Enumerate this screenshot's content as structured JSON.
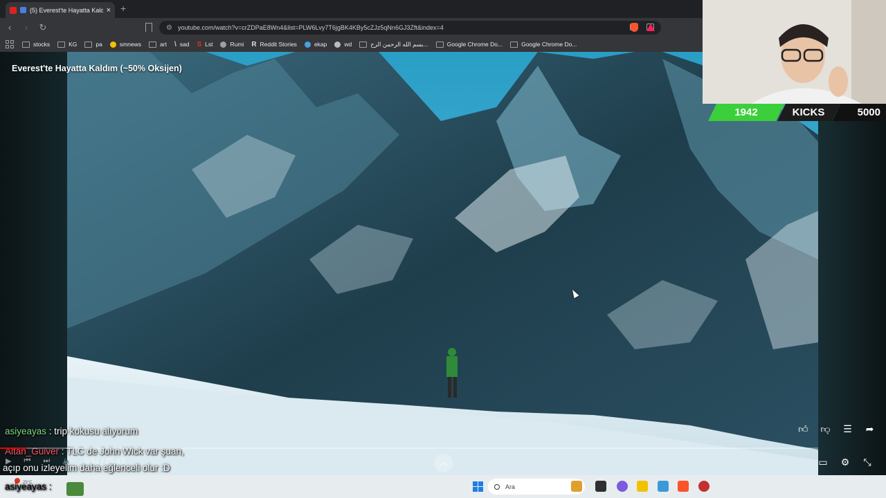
{
  "browser": {
    "tab": {
      "title": "(5) Everest'te Hayatta Kaldım"
    },
    "url": "youtube.com/watch?v=crZDPaE8Wn4&list=PLW6Lvy7T6jgBK4KBy5cZJz5qNn6GJ3Zft&index=4",
    "bookmarks": [
      {
        "label": "stocks",
        "kind": "folder"
      },
      {
        "label": "KG",
        "kind": "folder"
      },
      {
        "label": "pa",
        "kind": "folder"
      },
      {
        "label": "smnews",
        "kind": "site",
        "color": "#f2c200"
      },
      {
        "label": "art",
        "kind": "folder"
      },
      {
        "label": "sad",
        "kind": "site-glyph",
        "glyph": "\\"
      },
      {
        "label": "Lst",
        "kind": "site-glyph",
        "glyph": "S",
        "color": "#e0341f"
      },
      {
        "label": "Rumi",
        "kind": "site",
        "color": "#9aa0a6"
      },
      {
        "label": "Reddit Stories",
        "kind": "site-glyph",
        "glyph": "R"
      },
      {
        "label": "ekap",
        "kind": "site",
        "color": "#4aa0e0"
      },
      {
        "label": "wd",
        "kind": "site",
        "color": "#bbbbbb"
      },
      {
        "label": "بسم الله الرحمن الرح...",
        "kind": "doc"
      },
      {
        "label": "Google Chrome Do...",
        "kind": "folder"
      },
      {
        "label": "Google Chrome Do...",
        "kind": "folder"
      }
    ]
  },
  "video": {
    "title": "Everest'te Hayatta Kaldım (~50% Oksijen)",
    "time": "0:51 / 25:43",
    "progress": 0.033
  },
  "overlay": {
    "kicks_count": "1942",
    "kicks_label": "KICKS",
    "kicks_goal": "5000"
  },
  "chat": [
    {
      "user": "asiyeayas",
      "text": " : trip kokusu alıyorum"
    },
    {
      "user": "Altan_Guiver",
      "text": " : TLC de John Wick var şuan,"
    },
    {
      "user": "",
      "text": "açıp onu izleyelim daha eğlenceli olur :D"
    },
    {
      "user": "asiyeayas",
      "text": " : "
    }
  ],
  "taskbar": {
    "temp": "25°C",
    "search_placeholder": "Ara"
  },
  "colors": {
    "kicks_green": "#3ccf3c",
    "chat_user_green": "#7dd87d",
    "chat_user_red": "#ff5566"
  }
}
